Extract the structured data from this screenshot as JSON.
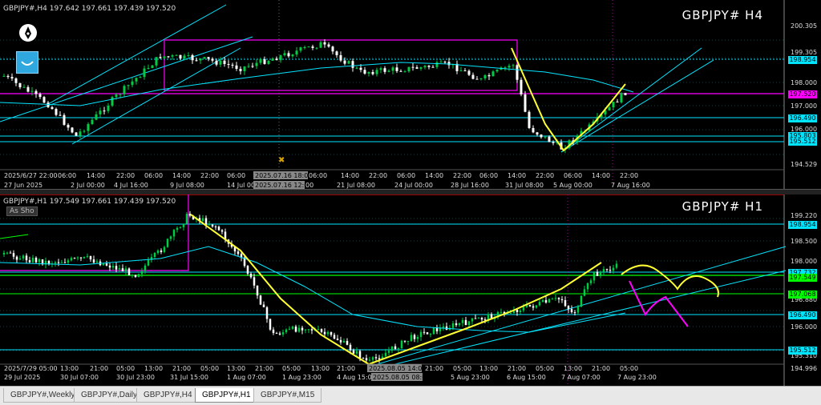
{
  "top_chart": {
    "info": "GBPJPY#,H4  197.642 197.661 197.439 197.520",
    "big_symbol": "GBPJPY#  H4",
    "price_labels": [
      "200.305",
      "199.305",
      "198.000",
      "197.000",
      "196.000",
      "194.529"
    ],
    "price_boxes": [
      {
        "value": "198.954",
        "color": "#00e5ff",
        "text_color": "#000"
      },
      {
        "value": "197.520",
        "color": "#ff00ff",
        "text_color": "#000"
      },
      {
        "value": "196.490",
        "color": "#00e5ff",
        "text_color": "#000"
      },
      {
        "value": "195.803",
        "color": "#00e5ff",
        "text_color": "#000"
      },
      {
        "value": "195.512",
        "color": "#00e5ff",
        "text_color": "#000"
      }
    ],
    "time_labels": [
      "2025/6/27 22:00",
      "06:00",
      "14:00",
      "22:00",
      "06:00",
      "14:00",
      "22:00",
      "06:00",
      "2025.07.16 18:00",
      "06:00",
      "14:00",
      "22:00",
      "06:00",
      "14:00",
      "22:00",
      "06:00",
      "14:00",
      "22:00",
      "06:00",
      "14:00",
      "22:00"
    ],
    "date_labels": [
      "27 Jun 2025",
      "2 Jul 00:00",
      "4 Jul 16:00",
      "9 Jul 08:00",
      "14 Jul 00:",
      "2025.07.16 12:00",
      "00",
      "21 Jul 08:00",
      "24 Jul 00:00",
      "28 Jul 16:00",
      "31 Jul 08:00",
      "5 Aug 00:00",
      "7 Aug 16:00"
    ]
  },
  "bottom_chart": {
    "info": "GBPJPY#,H1  197.549 197.661 197.439 197.520",
    "big_symbol": "GBPJPY#  H1",
    "as_show": "As Sho",
    "price_labels": [
      "199.220",
      "198.500",
      "198.000",
      "196.880",
      "196.000",
      "195.310",
      "194.996"
    ],
    "price_boxes": [
      {
        "value": "198.954",
        "color": "#00e5ff",
        "text_color": "#000"
      },
      {
        "value": "197.732",
        "color": "#00e5ff",
        "text_color": "#000"
      },
      {
        "value": "197.549",
        "color": "#00ff00",
        "text_color": "#000"
      },
      {
        "value": "197.068",
        "color": "#00ff00",
        "text_color": "#000"
      },
      {
        "value": "196.490",
        "color": "#00e5ff",
        "text_color": "#000"
      },
      {
        "value": "195.512",
        "color": "#00e5ff",
        "text_color": "#000"
      }
    ],
    "time_labels": [
      "2025/7/29 05:00",
      "13:00",
      "21:00",
      "05:00",
      "13:00",
      "21:00",
      "05:00",
      "13:00",
      "21:00",
      "05:00",
      "13:00",
      "21:00",
      "2025.08.05 14:00",
      "21:00",
      "05:00",
      "13:00",
      "21:00",
      "05:00",
      "13:00",
      "21:00",
      "05:00"
    ],
    "date_labels": [
      "29 Jul 2025",
      "30 Jul 07:00",
      "30 Jul 23:00",
      "31 Jul 15:00",
      "1 Aug 07:00",
      "1 Aug 23:00",
      "4 Aug 15:00",
      "2025.08.05 08:00",
      "5 Aug 23:00",
      "6 Aug 15:00",
      "7 Aug 07:00",
      "7 Aug 23:00"
    ]
  },
  "tabs": [
    {
      "label": "GBPJPY#,Weekly",
      "active": false
    },
    {
      "label": "GBPJPY#,Daily",
      "active": false
    },
    {
      "label": "GBPJPY#,H4",
      "active": false
    },
    {
      "label": "GBPJPY#,H1",
      "active": true
    },
    {
      "label": "GBPJPY#,M15",
      "active": false
    }
  ],
  "colors": {
    "bull": "#00cc44",
    "line_cyan": "#00e5ff",
    "yellow": "#ffff33",
    "magenta": "#ff00ff",
    "grid": "#2a2a2a"
  }
}
